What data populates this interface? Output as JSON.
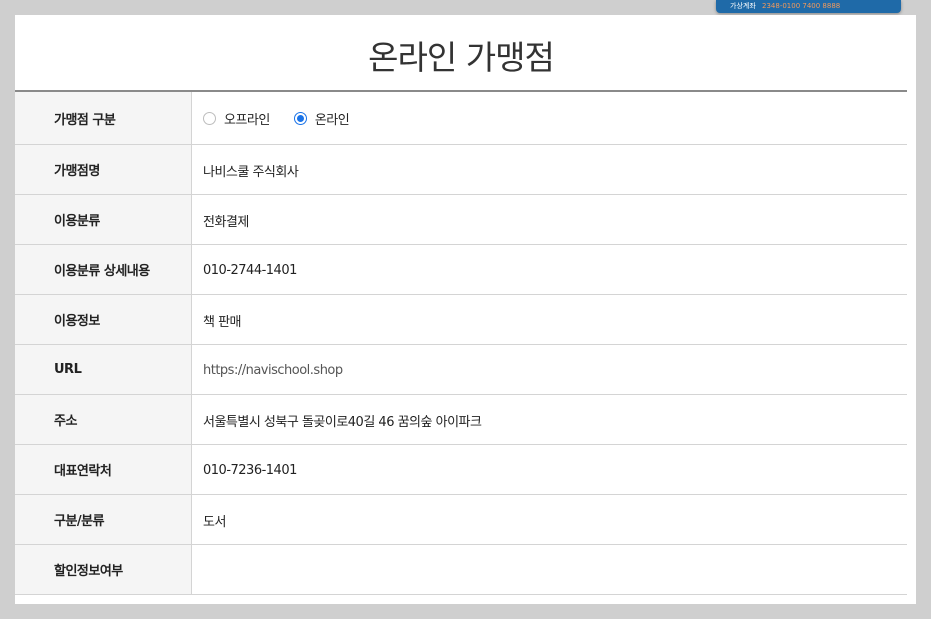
{
  "banner": {
    "label": "가상계좌",
    "number": "2348-0100 7400 8888"
  },
  "page": {
    "title": "온라인 가맹점"
  },
  "form": {
    "type_row": {
      "label": "가맹점 구분",
      "options": [
        {
          "label": "오프라인",
          "checked": false
        },
        {
          "label": "온라인",
          "checked": true
        }
      ]
    },
    "rows": [
      {
        "label": "가맹점명",
        "value": "나비스쿨 주식회사"
      },
      {
        "label": "이용분류",
        "value": "전화결제"
      },
      {
        "label": "이용분류 상세내용",
        "value": "010-2744-1401"
      },
      {
        "label": "이용정보",
        "value": "책 판매"
      },
      {
        "label": "URL",
        "value": "https://navischool.shop"
      },
      {
        "label": "주소",
        "value": "서울특별시 성북구 돌곶이로40길 46 꿈의숲 아이파크"
      },
      {
        "label": "대표연락처",
        "value": "010-7236-1401"
      },
      {
        "label": "구분/분류",
        "value": "도서"
      },
      {
        "label": "할인정보여부",
        "value": ""
      }
    ]
  },
  "colors": {
    "background": "#cfcfcf",
    "header_cell": "#f5f5f5",
    "radio_accent": "#1a73e8",
    "banner": "#1f6aa8"
  }
}
